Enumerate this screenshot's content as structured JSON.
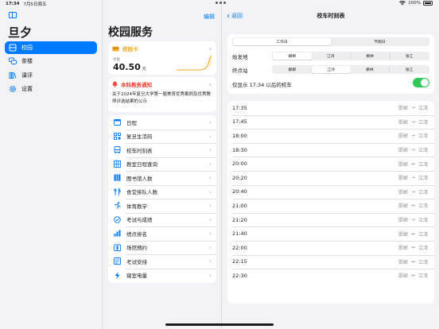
{
  "status": {
    "time": "17:34",
    "date": "7月5日周五",
    "battery": "100%"
  },
  "sidebar": {
    "title": "旦夕",
    "items": [
      {
        "label": "校园",
        "icon": "square-split-icon",
        "active": true
      },
      {
        "label": "茶楼",
        "icon": "chat-bubbles-icon",
        "active": false
      },
      {
        "label": "课评",
        "icon": "book-icon",
        "active": false
      },
      {
        "label": "设置",
        "icon": "gear-icon",
        "active": false
      }
    ]
  },
  "middle": {
    "edit": "编辑",
    "title": "校园服务",
    "campus_card": {
      "label": "校园卡",
      "balance_label": "余额",
      "balance": "40.50",
      "unit": "元"
    },
    "notice": {
      "label": "本科教务通知",
      "text": "关于2024年复旦大学第一届美育优秀案例及优秀教师评选结果的公示"
    },
    "services": [
      {
        "label": "日程",
        "icon": "calendar-icon"
      },
      {
        "label": "复旦生活码",
        "icon": "qrcode-icon"
      },
      {
        "label": "校车时刻表",
        "icon": "bus-icon"
      },
      {
        "label": "教室日程查询",
        "icon": "building-icon"
      },
      {
        "label": "图书馆人数",
        "icon": "library-icon"
      },
      {
        "label": "食堂排队人数",
        "icon": "utensils-icon"
      },
      {
        "label": "体育教学",
        "icon": "sports-icon"
      },
      {
        "label": "考试与成绩",
        "icon": "exam-icon"
      },
      {
        "label": "绩点排名",
        "icon": "chart-icon"
      },
      {
        "label": "场馆预约",
        "icon": "venue-icon"
      },
      {
        "label": "考试安排",
        "icon": "schedule-icon"
      },
      {
        "label": "寝室电量",
        "icon": "bolt-icon"
      }
    ]
  },
  "detail": {
    "back": "返回",
    "title": "校车时刻表",
    "day_type": {
      "options": [
        "工作日",
        "节假日"
      ],
      "selected": 0
    },
    "departure": {
      "label": "始发地",
      "options": [
        "邯郸",
        "江湾",
        "枫林",
        "张江"
      ],
      "selected": 0
    },
    "terminal": {
      "label": "终点站",
      "options": [
        "邯郸",
        "江湾",
        "枫林",
        "张江"
      ],
      "selected": 1
    },
    "only_after": {
      "label": "仅显示 17:34 以后的校车",
      "on": true
    },
    "times": [
      {
        "time": "17:35",
        "from": "邯郸",
        "to": "江湾"
      },
      {
        "time": "17:45",
        "from": "邯郸",
        "to": "江湾"
      },
      {
        "time": "18:00",
        "from": "邯郸",
        "to": "江湾"
      },
      {
        "time": "18:30",
        "from": "邯郸",
        "to": "江湾"
      },
      {
        "time": "20:00",
        "from": "邯郸",
        "to": "江湾"
      },
      {
        "time": "20:20",
        "from": "邯郸",
        "to": "江湾"
      },
      {
        "time": "20:40",
        "from": "邯郸",
        "to": "江湾"
      },
      {
        "time": "21:00",
        "from": "邯郸",
        "to": "江湾"
      },
      {
        "time": "21:20",
        "from": "邯郸",
        "to": "江湾"
      },
      {
        "time": "21:40",
        "from": "邯郸",
        "to": "江湾"
      },
      {
        "time": "22:00",
        "from": "邯郸",
        "to": "江湾"
      },
      {
        "time": "22:15",
        "from": "邯郸",
        "to": "江湾"
      },
      {
        "time": "22:30",
        "from": "邯郸",
        "to": "江湾"
      }
    ],
    "bidirectional": [
      false,
      false,
      false,
      false,
      true,
      false,
      false,
      true,
      false,
      true,
      true,
      true,
      true
    ]
  },
  "colors": {
    "accent": "#007aff",
    "toggle": "#34c759",
    "campus_card": "#f5a623",
    "notice": "#ff3b30"
  }
}
